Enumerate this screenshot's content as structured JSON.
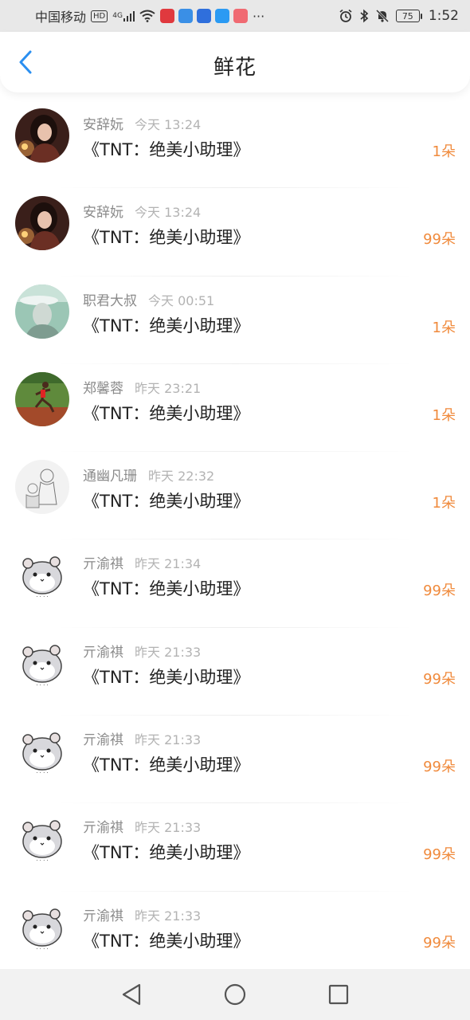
{
  "status_bar": {
    "carrier": "中国移动",
    "hd_badge": "HD",
    "network": "4G",
    "more": "···",
    "battery": "75",
    "time": "1:52",
    "app_icons": [
      {
        "name": "red-app-icon",
        "color": "#e0393e"
      },
      {
        "name": "blue-app-icon",
        "color": "#3a8fe6"
      },
      {
        "name": "bulb-app-icon",
        "color": "#2f6fdc"
      },
      {
        "name": "search-app-icon",
        "color": "#2b9af3"
      },
      {
        "name": "pink-app-icon",
        "color": "#f06a72"
      }
    ]
  },
  "header": {
    "title": "鲜花",
    "back_icon": "chevron-left-icon",
    "accent_color": "#2b8ff0"
  },
  "accent": {
    "count_color": "#f08a3c"
  },
  "items": [
    {
      "name": "安辞妧",
      "time": "今天 13:24",
      "book": "《TNT：绝美小助理》",
      "count": "1朵",
      "avatar": "portrait-dark"
    },
    {
      "name": "安辞妧",
      "time": "今天 13:24",
      "book": "《TNT：绝美小助理》",
      "count": "99朵",
      "avatar": "portrait-dark"
    },
    {
      "name": "职君大叔",
      "time": "今天 00:51",
      "book": "《TNT：绝美小助理》",
      "count": "1朵",
      "avatar": "portrait-green"
    },
    {
      "name": "郑馨蓉",
      "time": "昨天 23:21",
      "book": "《TNT：绝美小助理》",
      "count": "1朵",
      "avatar": "runner"
    },
    {
      "name": "通幽凡珊",
      "time": "昨天 22:32",
      "book": "《TNT：绝美小助理》",
      "count": "1朵",
      "avatar": "sketch"
    },
    {
      "name": "亓渝祺",
      "time": "昨天 21:34",
      "book": "《TNT：绝美小助理》",
      "count": "99朵",
      "avatar": "hamster"
    },
    {
      "name": "亓渝祺",
      "time": "昨天 21:33",
      "book": "《TNT：绝美小助理》",
      "count": "99朵",
      "avatar": "hamster"
    },
    {
      "name": "亓渝祺",
      "time": "昨天 21:33",
      "book": "《TNT：绝美小助理》",
      "count": "99朵",
      "avatar": "hamster"
    },
    {
      "name": "亓渝祺",
      "time": "昨天 21:33",
      "book": "《TNT：绝美小助理》",
      "count": "99朵",
      "avatar": "hamster"
    },
    {
      "name": "亓渝祺",
      "time": "昨天 21:33",
      "book": "《TNT：绝美小助理》",
      "count": "99朵",
      "avatar": "hamster"
    }
  ],
  "navbar": {
    "back": "triangle-back-icon",
    "home": "circle-home-icon",
    "recents": "square-recents-icon"
  }
}
